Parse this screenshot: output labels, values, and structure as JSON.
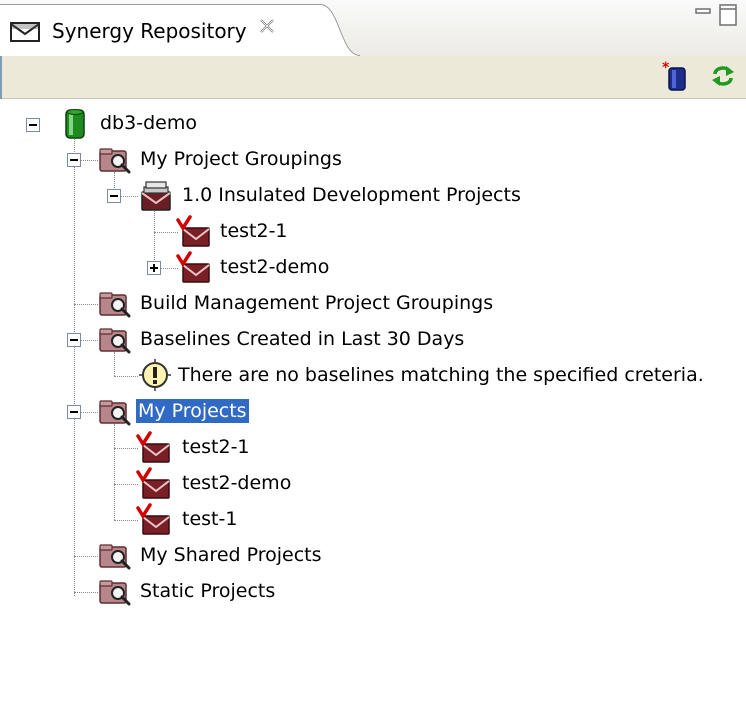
{
  "view": {
    "title": "Synergy Repository",
    "icons": {
      "tab": "envelope-icon",
      "close": "close-icon",
      "minimize": "minimize-icon",
      "maximize": "maximize-icon"
    }
  },
  "toolbar": {
    "buttons": [
      {
        "icon": "new-database-icon"
      },
      {
        "icon": "refresh-icon"
      }
    ]
  },
  "tree": {
    "root": {
      "label": "db3-demo",
      "icon": "database-icon"
    },
    "my_project_groupings": {
      "label": "My Project Groupings",
      "icon": "query-folder-icon",
      "children": {
        "insulated": {
          "label": "1.0 Insulated Development Projects",
          "icon": "project-grouping-icon",
          "children": [
            {
              "label": "test2-1",
              "icon": "project-icon"
            },
            {
              "label": "test2-demo",
              "icon": "project-icon"
            }
          ]
        }
      }
    },
    "build_management": {
      "label": "Build Management Project Groupings",
      "icon": "query-folder-icon"
    },
    "baselines": {
      "label": "Baselines Created in Last 30 Days",
      "icon": "query-folder-icon",
      "message": {
        "label": "There are no baselines matching the specified creteria.",
        "icon": "info-icon"
      }
    },
    "my_projects": {
      "label": "My Projects",
      "icon": "query-folder-icon",
      "selected": true,
      "children": [
        {
          "label": "test2-1",
          "icon": "project-icon"
        },
        {
          "label": "test2-demo",
          "icon": "project-icon"
        },
        {
          "label": "test-1",
          "icon": "project-icon"
        }
      ]
    },
    "my_shared_projects": {
      "label": "My Shared Projects",
      "icon": "query-folder-icon"
    },
    "static_projects": {
      "label": "Static Projects",
      "icon": "query-folder-icon"
    }
  }
}
